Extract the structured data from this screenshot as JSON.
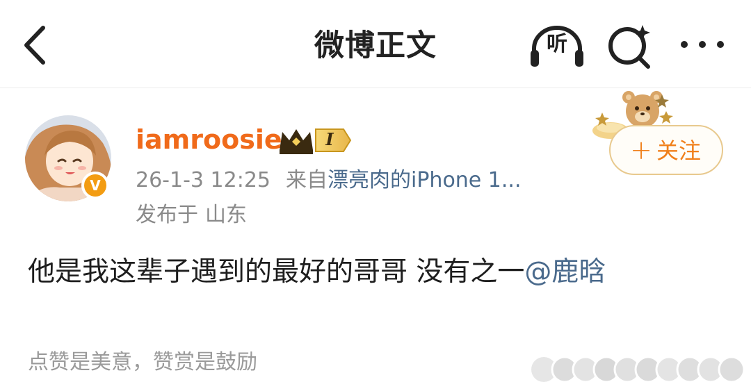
{
  "nav": {
    "title": "微博正文",
    "listen_label": "听"
  },
  "post": {
    "username": "iamroosie",
    "vip_level": "I",
    "verified_badge": "V",
    "time": "26-1-3 12:25",
    "from_prefix": "来自",
    "source": "漂亮肉的iPhone 1...",
    "location_prefix": "发布于",
    "location": "山东",
    "text": "他是我这辈子遇到的最好的哥哥 没有之一",
    "mention": "@鹿晗",
    "follow_plus": "+",
    "follow_label": "关注"
  },
  "footer": {
    "reward_text": "点赞是美意，赞赏是鼓励"
  },
  "colors": {
    "username": "#f06a1a",
    "link": "#4a6a8c",
    "meta": "#8a8a8a",
    "follow": "#f07f1a",
    "verified": "#f39c12"
  },
  "icons": {
    "back": "chevron-left-icon",
    "listen": "headphones-icon",
    "search": "search-sparkle-icon",
    "more": "more-dots-icon"
  }
}
